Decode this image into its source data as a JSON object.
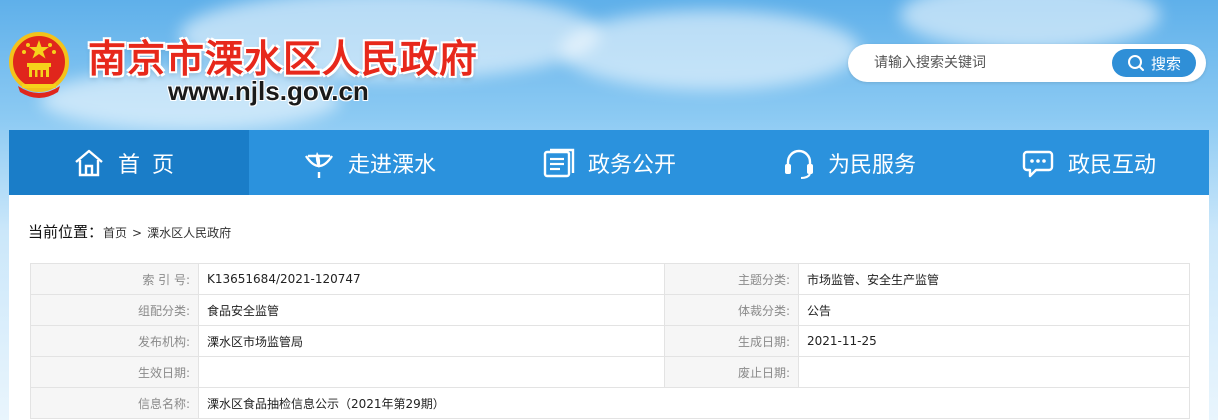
{
  "site": {
    "title": "南京市溧水区人民政府",
    "url": "www.njls.gov.cn"
  },
  "search": {
    "placeholder": "请输入搜索关键词",
    "button_label": "搜索"
  },
  "nav": {
    "items": [
      {
        "label": "首页",
        "icon": "home-icon",
        "active": true
      },
      {
        "label": "走进溧水",
        "icon": "leaf-icon"
      },
      {
        "label": "政务公开",
        "icon": "document-icon"
      },
      {
        "label": "为民服务",
        "icon": "headset-icon"
      },
      {
        "label": "政民互动",
        "icon": "chat-icon"
      }
    ]
  },
  "breadcrumb": {
    "label": "当前位置：",
    "items": [
      "首页",
      "溧水区人民政府"
    ],
    "separator": ">"
  },
  "meta": {
    "rows": [
      {
        "l1": "索 引 号:",
        "v1": "K13651684/2021-120747",
        "l2": "主题分类:",
        "v2": "市场监管、安全生产监管"
      },
      {
        "l1": "组配分类:",
        "v1": "食品安全监管",
        "l2": "体裁分类:",
        "v2": "公告"
      },
      {
        "l1": "发布机构:",
        "v1": "溧水区市场监管局",
        "l2": "生成日期:",
        "v2": "2021-11-25"
      },
      {
        "l1": "生效日期:",
        "v1": "",
        "l2": "废止日期:",
        "v2": ""
      }
    ],
    "info_name": {
      "label": "信息名称:",
      "value": "溧水区食品抽检信息公示（2021年第29期）"
    }
  },
  "colors": {
    "nav": "#2b92dd",
    "nav_active": "#1a7dc8",
    "title_red": "#e7281b",
    "search_button": "#2f8fd7"
  }
}
